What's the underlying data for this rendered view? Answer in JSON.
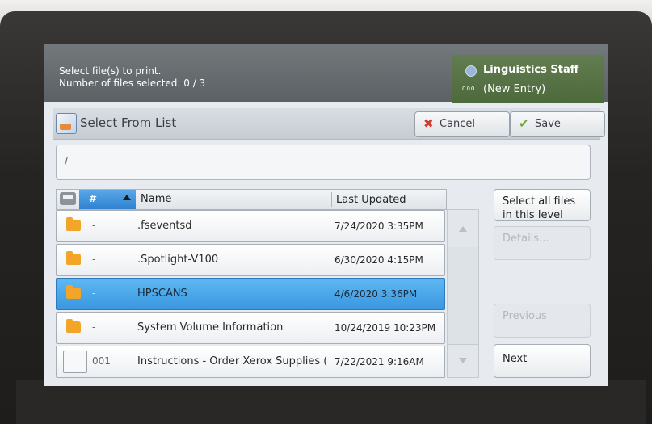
{
  "header": {
    "prompt": "Select file(s) to print.",
    "selected_count": "Number of files selected: 0 / 3",
    "user_name": "Linguistics Staff",
    "user_number_icon": "000",
    "user_entry": "(New Entry)"
  },
  "titlebar": {
    "title": "Select From List",
    "cancel_label": "Cancel",
    "save_label": "Save"
  },
  "path": "/",
  "list": {
    "columns": {
      "number": "#",
      "name": "Name",
      "last_updated": "Last Updated"
    },
    "rows": [
      {
        "number": "-",
        "name": ".fseventsd",
        "date": "7/24/2020 3:35PM",
        "type": "folder",
        "selected": false
      },
      {
        "number": "-",
        "name": ".Spotlight-V100",
        "date": "6/30/2020 4:15PM",
        "type": "folder",
        "selected": false
      },
      {
        "number": "-",
        "name": "HPSCANS",
        "date": "4/6/2020 3:36PM",
        "type": "folder",
        "selected": true
      },
      {
        "number": "-",
        "name": "System Volume Information",
        "date": "10/24/2019 10:23PM",
        "type": "folder",
        "selected": false
      },
      {
        "number": "001",
        "name": "Instructions - Order Xerox Supplies (",
        "date": "7/22/2021 9:16AM",
        "type": "file",
        "selected": false
      }
    ]
  },
  "side_buttons": {
    "select_all": "Select all files in this level",
    "details": "Details...",
    "previous": "Previous",
    "next": "Next"
  },
  "colors": {
    "selected_row": "#3a97e0",
    "user_panel": "#4d6a3c",
    "folder": "#f2a528"
  }
}
